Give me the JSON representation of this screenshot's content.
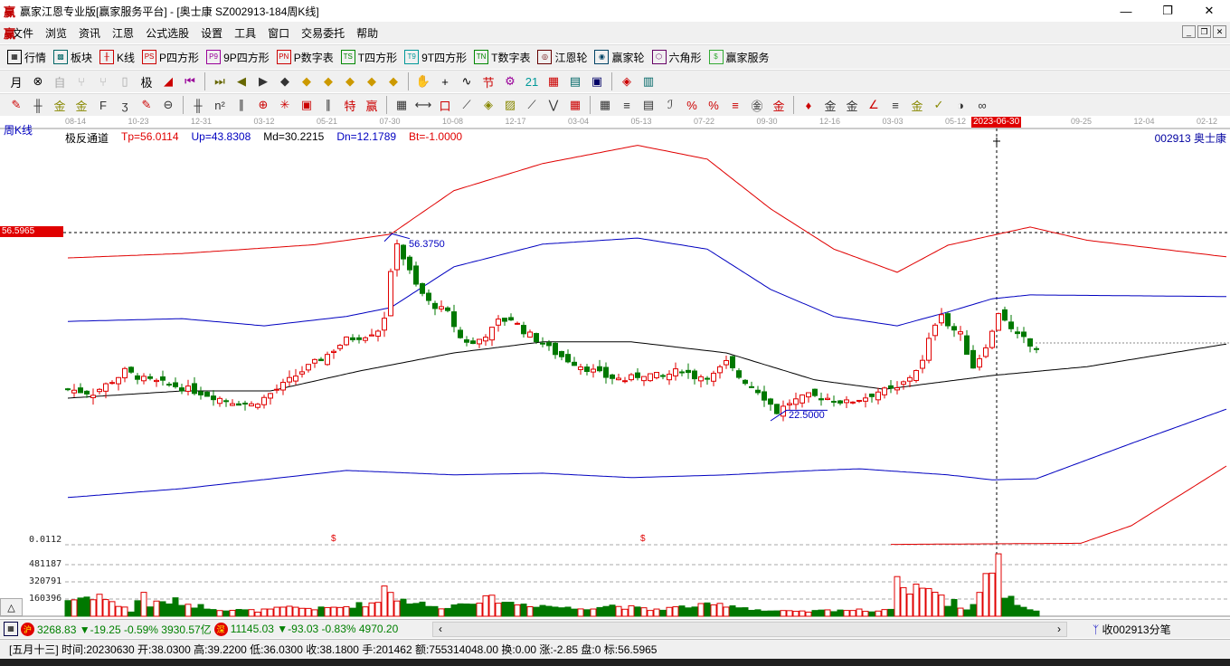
{
  "window": {
    "title": "赢家江恩专业版[赢家服务平台] - [奥士康  SZ002913-184周K线]",
    "logo": "赢",
    "min": "—",
    "max": "❐",
    "close": "✕"
  },
  "menu": [
    "文件",
    "浏览",
    "资讯",
    "江恩",
    "公式选股",
    "设置",
    "工具",
    "窗口",
    "交易委托",
    "帮助"
  ],
  "toolbar1": [
    {
      "icon": "table-icon",
      "g": "▦",
      "label": "行情"
    },
    {
      "icon": "blocks-icon",
      "g": "▩",
      "label": "板块"
    },
    {
      "icon": "kline-icon",
      "g": "╫",
      "label": "K线"
    },
    {
      "icon": "ps-icon",
      "g": "PS",
      "label": "P四方形"
    },
    {
      "icon": "p9-icon",
      "g": "P9",
      "label": "9P四方形"
    },
    {
      "icon": "pn-icon",
      "g": "PN",
      "label": "P数字表"
    },
    {
      "icon": "ts-icon",
      "g": "TS",
      "label": "T四方形"
    },
    {
      "icon": "t9-icon",
      "g": "T9",
      "label": "9T四方形"
    },
    {
      "icon": "tn-icon",
      "g": "TN",
      "label": "T数字表"
    },
    {
      "icon": "gann-wheel-icon",
      "g": "◎",
      "label": "江恩轮"
    },
    {
      "icon": "winner-wheel-icon",
      "g": "◉",
      "label": "赢家轮"
    },
    {
      "icon": "hexagon-icon",
      "g": "⬡",
      "label": "六角形"
    },
    {
      "icon": "dollar-icon",
      "g": "$",
      "label": "赢家服务"
    }
  ],
  "toolbar2": {
    "period": "月",
    "glyphs": [
      "⊗",
      "自",
      "⑂",
      "⑂",
      "▯",
      "极",
      "◢",
      "⏮",
      "⏭",
      "◀",
      "▶",
      "◆",
      "◆",
      "◆",
      "◆",
      "◆",
      "◆",
      "✋",
      "+",
      "∿",
      "节",
      "⚙",
      "21",
      "▦",
      "▤",
      "▣",
      "◈",
      "▥"
    ]
  },
  "toolbar3": {
    "glyphs": [
      "✎",
      "╫",
      "金",
      "金",
      "F",
      "ʒ",
      "✎",
      "⊖",
      "╫",
      "n²",
      "∥",
      "⊕",
      "✳",
      "▣",
      "∥",
      "特",
      "赢",
      "▦",
      "⟷",
      "口",
      "⟋",
      "◈",
      "▨",
      "⟋",
      "⋁",
      "▦",
      "▦",
      "≡",
      "▤",
      "ℐ",
      "%",
      "%",
      "≡",
      "㊎",
      "金",
      "♦",
      "金",
      "金",
      "∠",
      "≡",
      "金",
      "✓",
      "◑",
      "∞"
    ]
  },
  "chart": {
    "period_label": "周K线",
    "date_ticks": [
      "08-14",
      "10-23",
      "12-31",
      "03-12",
      "05-21",
      "07-30",
      "10-08",
      "12-17",
      "03-04",
      "05-13",
      "07-22",
      "09-30",
      "12-16",
      "03-03",
      "05-12",
      "",
      "09-25",
      "12-04",
      "02-12"
    ],
    "cursor_date": "2023-06-30",
    "indicator": {
      "name": "极反通道",
      "tp": "Tp=56.0114",
      "up": "Up=43.8308",
      "md": "Md=30.2215",
      "dn": "Dn=12.1789",
      "bt": "Bt=-1.0000"
    },
    "stock": "002913  奥士康",
    "cursor_price": "56.5965",
    "high_label": "56.3750",
    "low_label": "22.5000",
    "volume_labels": [
      "0.0112",
      "481187",
      "320791",
      "160396"
    ],
    "signal_marks": [
      "$",
      "$"
    ],
    "colors": {
      "up": "#e00000",
      "down": "#007800",
      "top": "#e00000",
      "upper": "#0000c0",
      "mid": "#000000",
      "lower": "#0000c0"
    },
    "price_path": [
      [
        0,
        28.2
      ],
      [
        4,
        27.5
      ],
      [
        8,
        30.5
      ],
      [
        9,
        31.5
      ],
      [
        12,
        30
      ],
      [
        17,
        28.8
      ],
      [
        21,
        27.6
      ],
      [
        25,
        26.2
      ],
      [
        29,
        25.4
      ],
      [
        31,
        26.6
      ],
      [
        34,
        29
      ],
      [
        37,
        31.5
      ],
      [
        41,
        34.5
      ],
      [
        44,
        37.2
      ],
      [
        47,
        38
      ],
      [
        49,
        39
      ],
      [
        50,
        41.4
      ],
      [
        51,
        49
      ],
      [
        52,
        55
      ],
      [
        53,
        52
      ],
      [
        54,
        49.5
      ],
      [
        55,
        47
      ],
      [
        57,
        44
      ],
      [
        60,
        42
      ],
      [
        62,
        37.5
      ],
      [
        64,
        36.4
      ],
      [
        67,
        39
      ],
      [
        68,
        40.5
      ],
      [
        70,
        41
      ],
      [
        72,
        38.8
      ],
      [
        75,
        36.5
      ],
      [
        77,
        34.8
      ],
      [
        79,
        33.5
      ],
      [
        82,
        32
      ],
      [
        85,
        30.5
      ],
      [
        88,
        29.9
      ],
      [
        91,
        31
      ],
      [
        94,
        30.5
      ],
      [
        97,
        31.8
      ],
      [
        99,
        30.5
      ],
      [
        102,
        30.8
      ],
      [
        104,
        33
      ],
      [
        106,
        30.5
      ],
      [
        109,
        28
      ],
      [
        111,
        25.5
      ],
      [
        112,
        24.1
      ],
      [
        114,
        25.8
      ],
      [
        117,
        27
      ],
      [
        120,
        26.6
      ],
      [
        123,
        25.8
      ],
      [
        126,
        26.8
      ],
      [
        128,
        27.8
      ],
      [
        131,
        28.2
      ],
      [
        133,
        30.5
      ],
      [
        135,
        33.2
      ],
      [
        136,
        37
      ],
      [
        137,
        40.2
      ],
      [
        138,
        42.2
      ],
      [
        139,
        39.8
      ],
      [
        141,
        38.1
      ],
      [
        142,
        35
      ],
      [
        143,
        32.3
      ],
      [
        144,
        34
      ],
      [
        146,
        38.5
      ],
      [
        147,
        42.2
      ],
      [
        148,
        41
      ],
      [
        149,
        38.9
      ],
      [
        150,
        37.8
      ],
      [
        151,
        37.3
      ],
      [
        152,
        36
      ],
      [
        153,
        35.6
      ]
    ],
    "volume_path": [
      [
        0,
        150000
      ],
      [
        3,
        180000
      ],
      [
        5,
        200000
      ],
      [
        7,
        120000
      ],
      [
        9,
        90000
      ],
      [
        10,
        40000
      ],
      [
        12,
        230000
      ],
      [
        13,
        100000
      ],
      [
        14,
        120000
      ],
      [
        17,
        140000
      ],
      [
        20,
        100000
      ],
      [
        25,
        60000
      ],
      [
        30,
        50000
      ],
      [
        35,
        80000
      ],
      [
        40,
        70000
      ],
      [
        44,
        90000
      ],
      [
        49,
        130000
      ],
      [
        50,
        300000
      ],
      [
        51,
        260000
      ],
      [
        52,
        160000
      ],
      [
        55,
        130000
      ],
      [
        58,
        80000
      ],
      [
        61,
        100000
      ],
      [
        64,
        150000
      ],
      [
        68,
        160000
      ],
      [
        70,
        120000
      ],
      [
        75,
        100000
      ],
      [
        80,
        70000
      ],
      [
        86,
        100000
      ],
      [
        92,
        60000
      ],
      [
        98,
        90000
      ],
      [
        104,
        110000
      ],
      [
        110,
        50000
      ],
      [
        116,
        40000
      ],
      [
        122,
        60000
      ],
      [
        128,
        50000
      ],
      [
        130,
        80000
      ],
      [
        131,
        300000
      ],
      [
        132,
        350000
      ],
      [
        133,
        200000
      ],
      [
        134,
        280000
      ],
      [
        135,
        320000
      ],
      [
        136,
        250000
      ],
      [
        137,
        220000
      ],
      [
        138,
        170000
      ],
      [
        139,
        110000
      ],
      [
        140,
        140000
      ],
      [
        141,
        90000
      ],
      [
        142,
        60000
      ],
      [
        143,
        120000
      ],
      [
        144,
        250000
      ],
      [
        145,
        390000
      ],
      [
        146,
        430000
      ],
      [
        147,
        680000
      ],
      [
        148,
        170000
      ],
      [
        149,
        150000
      ],
      [
        150,
        130000
      ],
      [
        151,
        90000
      ],
      [
        152,
        70000
      ],
      [
        153,
        40000
      ]
    ],
    "bands": {
      "top": [
        [
          0,
          52.0
        ],
        [
          18,
          52.8
        ],
        [
          39,
          54.4
        ],
        [
          51,
          56.3
        ],
        [
          61,
          64.2
        ],
        [
          75,
          69.1
        ],
        [
          90,
          72.4
        ],
        [
          101,
          69.9
        ],
        [
          111,
          60.9
        ],
        [
          121,
          53.6
        ],
        [
          131,
          49.4
        ],
        [
          139,
          54.3
        ],
        [
          152,
          57.6
        ],
        [
          161,
          55.2
        ],
        [
          183,
          52.2
        ]
      ],
      "upper": [
        [
          0,
          40.5
        ],
        [
          18,
          41
        ],
        [
          31,
          39.7
        ],
        [
          44,
          41.4
        ],
        [
          51,
          43
        ],
        [
          61,
          50.4
        ],
        [
          75,
          54.5
        ],
        [
          90,
          55.6
        ],
        [
          101,
          53.6
        ],
        [
          111,
          46.3
        ],
        [
          121,
          41.4
        ],
        [
          131,
          39.7
        ],
        [
          139,
          42.2
        ],
        [
          146,
          44.6
        ],
        [
          152,
          45.3
        ],
        [
          183,
          45
        ]
      ],
      "mid": [
        [
          0,
          26.6
        ],
        [
          18,
          27.9
        ],
        [
          32,
          27.9
        ],
        [
          46,
          31.5
        ],
        [
          61,
          34.8
        ],
        [
          75,
          36.8
        ],
        [
          89,
          36.8
        ],
        [
          104,
          34.8
        ],
        [
          118,
          29.9
        ],
        [
          129,
          28.2
        ],
        [
          146,
          30.7
        ],
        [
          161,
          32.3
        ],
        [
          183,
          36.4
        ]
      ],
      "lower": [
        [
          0,
          8.6
        ],
        [
          18,
          10.2
        ],
        [
          44,
          13.5
        ],
        [
          61,
          12.7
        ],
        [
          75,
          13
        ],
        [
          89,
          12.2
        ],
        [
          104,
          12.7
        ],
        [
          118,
          13.5
        ],
        [
          125,
          13.8
        ],
        [
          139,
          12.7
        ],
        [
          146,
          11.8
        ],
        [
          153,
          12
        ],
        [
          168,
          18.4
        ],
        [
          183,
          24.6
        ]
      ],
      "bottom": [
        [
          130,
          0.1
        ],
        [
          160,
          0.3
        ],
        [
          168,
          3.5
        ],
        [
          183,
          14.3
        ]
      ]
    }
  },
  "index_bar": {
    "sh_badge": "沪",
    "sh": "3268.83 ▼-19.25 -0.59% 3930.57亿",
    "sz_badge": "深",
    "sz": "11145.03 ▼-93.03 -0.83% 4970.20",
    "scroll_left": "‹",
    "scroll_right": "›",
    "sub": "收002913分笔"
  },
  "status": "[五月十三] 时间:20230630 开:38.0300 高:39.2200 低:36.0300 收:38.1800 手:201462 额:755314048.00 换:0.00 涨:-2.85 盘:0 标:56.5965"
}
